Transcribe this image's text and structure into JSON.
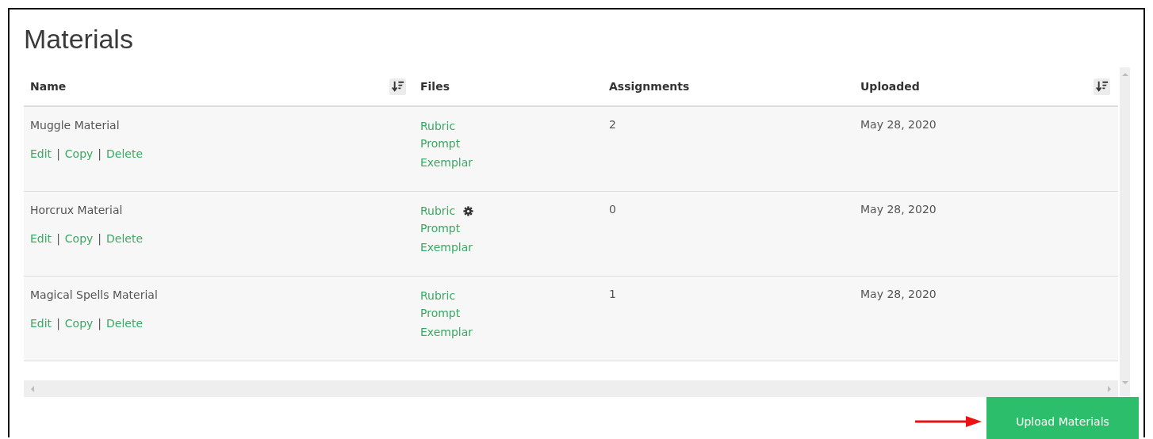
{
  "title": "Materials",
  "table": {
    "columns": [
      {
        "label": "Name",
        "kind": "sortable"
      },
      {
        "label": "Files",
        "kind": "plain"
      },
      {
        "label": "Assignments",
        "kind": "plain"
      },
      {
        "label": "Uploaded",
        "kind": "sortable"
      }
    ],
    "rows": [
      {
        "name": "Muggle Material",
        "actions": [
          {
            "kind": "link",
            "text": "Edit"
          },
          {
            "kind": "separator",
            "text": "|"
          },
          {
            "kind": "link",
            "text": "Copy"
          },
          {
            "kind": "separator",
            "text": "|"
          },
          {
            "kind": "link",
            "text": "Delete"
          }
        ],
        "files": [
          {
            "label": "Rubric",
            "kind": "link"
          },
          {
            "label": "Prompt",
            "kind": "link"
          },
          {
            "label": "Exemplar",
            "kind": "link"
          }
        ],
        "assignments": "2",
        "uploaded": "May 28, 2020"
      },
      {
        "name": "Horcrux Material",
        "actions": [
          {
            "kind": "link",
            "text": "Edit"
          },
          {
            "kind": "separator",
            "text": "|"
          },
          {
            "kind": "link",
            "text": "Copy"
          },
          {
            "kind": "separator",
            "text": "|"
          },
          {
            "kind": "link",
            "text": "Delete"
          }
        ],
        "files": [
          {
            "label": "Rubric",
            "kind": "link_with_settings"
          },
          {
            "label": "Prompt",
            "kind": "link"
          },
          {
            "label": "Exemplar",
            "kind": "link"
          }
        ],
        "assignments": "0",
        "uploaded": "May 28, 2020"
      },
      {
        "name": "Magical Spells Material",
        "actions": [
          {
            "kind": "link",
            "text": "Edit"
          },
          {
            "kind": "separator",
            "text": "|"
          },
          {
            "kind": "link",
            "text": "Copy"
          },
          {
            "kind": "separator",
            "text": "|"
          },
          {
            "kind": "link",
            "text": "Delete"
          }
        ],
        "files": [
          {
            "label": "Rubric",
            "kind": "link"
          },
          {
            "label": "Prompt",
            "kind": "link"
          },
          {
            "label": "Exemplar",
            "kind": "link"
          }
        ],
        "assignments": "1",
        "uploaded": "May 28, 2020"
      }
    ]
  },
  "upload_button": "Upload Materials"
}
